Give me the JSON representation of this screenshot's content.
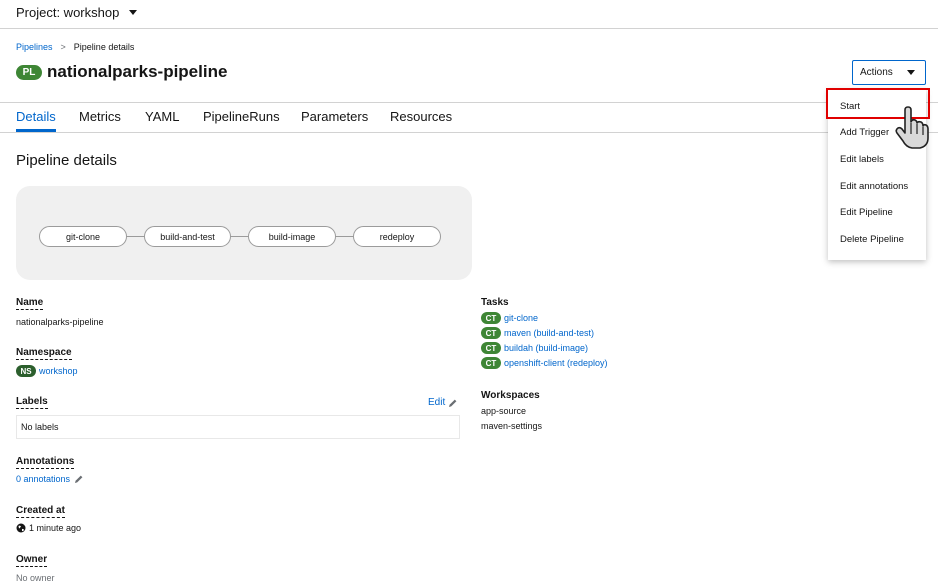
{
  "project": {
    "label": "Project: workshop"
  },
  "breadcrumb": {
    "root": "Pipelines",
    "separator": ">",
    "current": "Pipeline details"
  },
  "header": {
    "badge": "PL",
    "title": "nationalparks-pipeline",
    "actions_label": "Actions"
  },
  "tabs": [
    {
      "label": "Details"
    },
    {
      "label": "Metrics"
    },
    {
      "label": "YAML"
    },
    {
      "label": "PipelineRuns"
    },
    {
      "label": "Parameters"
    },
    {
      "label": "Resources"
    }
  ],
  "section_title": "Pipeline details",
  "topology": {
    "nodes": [
      "git-clone",
      "build-and-test",
      "build-image",
      "redeploy"
    ]
  },
  "details": {
    "name": {
      "label": "Name",
      "value": "nationalparks-pipeline"
    },
    "namespace": {
      "label": "Namespace",
      "badge": "NS",
      "value": "workshop"
    },
    "labels": {
      "label": "Labels",
      "edit": "Edit",
      "empty": "No labels"
    },
    "annotations": {
      "label": "Annotations",
      "value": "0 annotations"
    },
    "created": {
      "label": "Created at",
      "value": "1 minute ago"
    },
    "owner": {
      "label": "Owner",
      "value": "No owner"
    }
  },
  "tasks": {
    "label": "Tasks",
    "badge": "CT",
    "items": [
      "git-clone",
      "maven (build-and-test)",
      "buildah (build-image)",
      "openshift-client (redeploy)"
    ]
  },
  "workspaces": {
    "label": "Workspaces",
    "items": [
      "app-source",
      "maven-settings"
    ]
  },
  "actions_menu": {
    "items": [
      "Start",
      "Add Trigger",
      "Edit labels",
      "Edit annotations",
      "Edit Pipeline",
      "Delete Pipeline"
    ]
  },
  "colors": {
    "link": "#0066cc",
    "badge_green": "#3e8635",
    "highlight": "#e00000"
  }
}
